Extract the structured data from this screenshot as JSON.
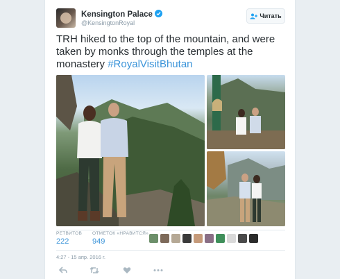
{
  "tweet": {
    "author_name": "Kensington Palace",
    "author_handle": "@KensingtonRoyal",
    "follow_label": "Читать",
    "text_main": "TRH hiked to the top of the mountain, and were taken by monks through the temples at the monastery ",
    "hashtag": "#RoyalVisitBhutan",
    "timestamp": "4:27 - 15 апр. 2016 г."
  },
  "stats": {
    "retweets_label": "РЕТВИТОВ",
    "retweets_value": "222",
    "likes_label": "ОТМЕТОК «НРАВИТСЯ»",
    "likes_value": "949"
  },
  "icons": {
    "verified": "verified-badge-icon",
    "follow": "add-person-icon",
    "reply": "reply-icon",
    "retweet": "retweet-icon",
    "like": "heart-icon",
    "more": "more-dots-icon"
  },
  "colors": {
    "link": "#3b94d9",
    "verified": "#1da1f2",
    "meta": "#8899a6"
  }
}
